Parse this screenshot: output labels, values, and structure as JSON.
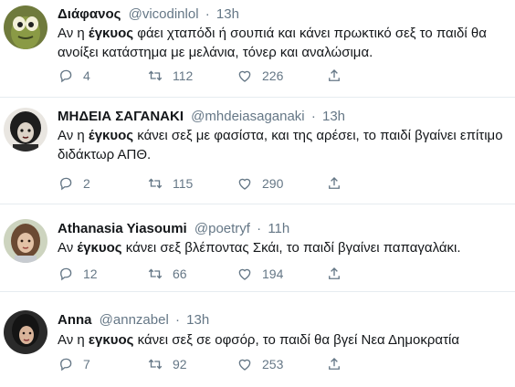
{
  "tweets": [
    {
      "name": "Διάφανος",
      "handle": "@vicodinlol",
      "time": "13h",
      "lines": [
        [
          "Αν η ",
          "έγκυος",
          " φάει χταπόδι ή σουπιά και κάνει πρωκτικό σεξ το παιδί θα"
        ],
        [
          "ανοίξει κατάστημα με μελάνια, τόνερ και αναλώσιμα.",
          "",
          ""
        ]
      ],
      "replies": "4",
      "retweets": "112",
      "likes": "226"
    },
    {
      "name": "ΜΗΔΕΙΑ ΣΑΓΑΝΑΚΙ",
      "handle": "@mhdeiasaganaki",
      "time": "13h",
      "lines": [
        [
          "Αν η ",
          "έγκυος",
          " κάνει σεξ με φασίστα, και της αρέσει, το παιδί βγαίνει επίτιμο"
        ],
        [
          "διδάκτωρ ΑΠΘ.",
          "",
          ""
        ]
      ],
      "replies": "2",
      "retweets": "115",
      "likes": "290"
    },
    {
      "name": "Athanasia Yiasoumi",
      "handle": "@poetryf",
      "time": "11h",
      "lines": [
        [
          "Αν ",
          "έγκυος",
          " κάνει σεξ βλέποντας Σκάι, το παιδί βγαίνει παπαγαλάκι."
        ]
      ],
      "replies": "12",
      "retweets": "66",
      "likes": "194"
    },
    {
      "name": "Anna",
      "handle": "@annzabel",
      "time": "13h",
      "lines": [
        [
          "Αν η ",
          "εγκυος",
          " κάνει σεξ σε οφσόρ, το παιδί θα βγεί Νεα Δημοκρατία"
        ]
      ],
      "replies": "7",
      "retweets": "92",
      "likes": "253"
    }
  ],
  "icons": {
    "reply": "reply-icon",
    "retweet": "retweet-icon",
    "like": "heart-icon",
    "share": "share-icon"
  },
  "colors": {
    "text": "#14171a",
    "secondary": "#657786",
    "divider": "#e6ecf0"
  }
}
